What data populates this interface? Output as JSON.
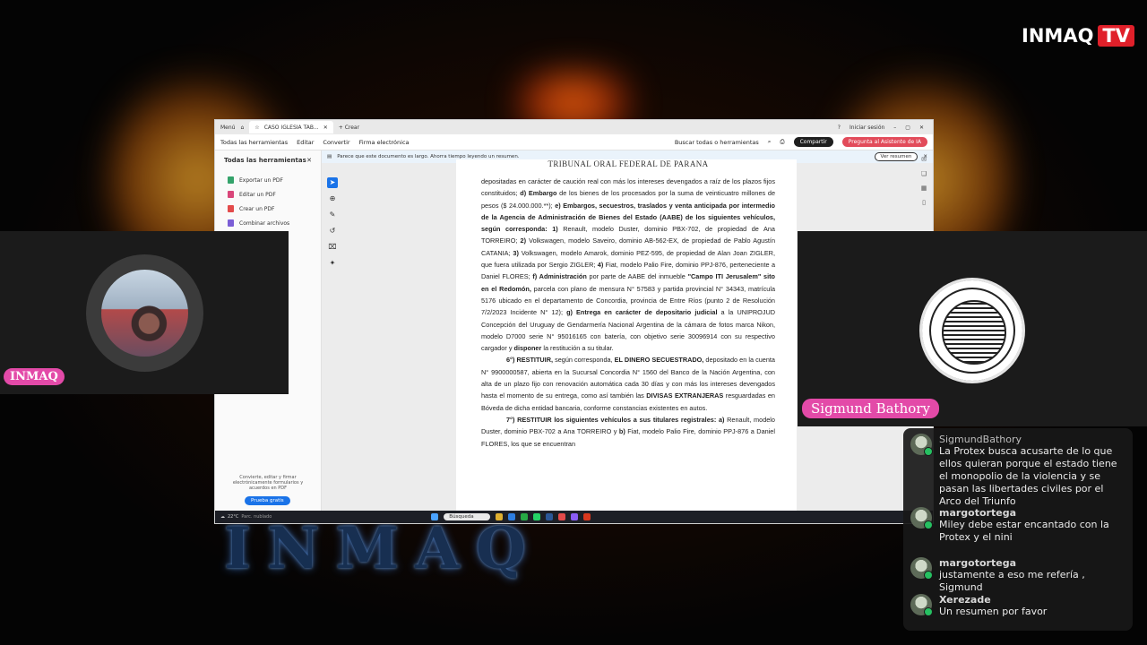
{
  "brand": {
    "name": "INMAQ",
    "tv": "TV"
  },
  "background_text": "INMAQ",
  "acrobat": {
    "tabs": {
      "menu": "Menú",
      "doc_tab": "CASO IGLESIA TAB...",
      "new_tab": "Crear"
    },
    "signin": "Iniciar sesión",
    "menu": [
      "Todas las herramientas",
      "Editar",
      "Convertir",
      "Firma electrónica"
    ],
    "search_tools": "Buscar todas o herramientas",
    "share": "Compartir",
    "ai_button": "Pregunta al Asistente de IA",
    "tools_panel": {
      "title": "Todas las herramientas",
      "items": [
        "Exportar un PDF",
        "Editar un PDF",
        "Crear un PDF",
        "Combinar archivos"
      ],
      "promo": "Convierte, editar y firmar electrónicamente formularios y acuerdos en PDF",
      "trial": "Prueba gratis"
    },
    "banner": {
      "text": "Parece que este documento es largo. Ahorra tiempo leyendo un resumen.",
      "button": "Ver resumen"
    },
    "document": {
      "header": "TRIBUNAL ORAL FEDERAL DE PARANA",
      "p1": [
        "depositadas en carácter de caución real con más los intereses devengados a raíz de los plazos fijos constituidos; ",
        "d) Embargo",
        " de los bienes de los procesados por la suma de veinticuatro millones de pesos ($ 24.000.000.**); ",
        "e) Embargos, secuestros, traslados y venta anticipada por intermedio de la Agencia de Administración de Bienes del Estado (AABE) de los siguientes vehículos, según corresponda: 1)",
        " Renault, modelo Duster, dominio PBX-702, de propiedad de Ana TORREIRO; ",
        "2)",
        " Volkswagen, modelo Saveiro, dominio AB-562-EX, de propiedad de Pablo Agustín CATANIA; ",
        "3)",
        " Volkswagen, modelo Amarok, dominio PEZ-595, de propiedad de Alan Joan ZIGLER, que fuera utilizada por Sergio ZIGLER; ",
        "4)",
        " Fiat, modelo Palio Fire, dominio PPJ-876, perteneciente a Daniel FLORES; ",
        "f) Administración",
        " por parte de AABE del inmueble ",
        "\"Campo ITI Jerusalem\" sito en el Redomón,",
        " parcela con plano de mensura N° 57583 y partida provincial N° 34343, matrícula 5176 ubicado en el departamento de Concordia, provincia de Entre Ríos (punto 2 de Resolución 7/2/2023 Incidente N° 12); ",
        "g) Entrega en carácter de depositario judicial",
        " a la UNIPROJUD Concepción del Uruguay de Gendarmería Nacional Argentina de la cámara de fotos marca Nikon, modelo D7000 serie N° 95016165 con batería, con objetivo serie 30096914 con su respectivo cargador y ",
        "disponer",
        " la restitución a su titular."
      ],
      "p2": [
        "6°) RESTITUIR,",
        " según corresponda, ",
        "EL DINERO SECUESTRADO,",
        " depositado en la cuenta N° 9900000587, abierta en la Sucursal Concordia N° 1560 del Banco de la Nación Argentina, con alta de un plazo fijo con renovación automática cada 30 días y con más los intereses devengados hasta el momento de su entrega, como así también las ",
        "DIVISAS EXTRANJERAS",
        " resguardadas en Bóveda de dicha entidad bancaria, conforme constancias existentes en autos."
      ],
      "p3": [
        "7°) RESTITUIR los siguientes vehículos a sus titulares registrales: a)",
        " Renault, modelo Duster, dominio PBX-702 a Ana TORREIRO y ",
        "b)",
        " Fiat, modelo Palio Fire, dominio PPJ-876 a Daniel FLORES, los que se encuentran"
      ]
    },
    "taskbar": {
      "weather": "22°C",
      "weather_sub": "Parc. nublado",
      "search": "Búsqueda"
    }
  },
  "hosts": {
    "left_tag": "INMAQ",
    "right_tag": "Sigmund Bathory"
  },
  "chat": [
    {
      "name": "SigmundBathory",
      "text": "La Protex busca acusarte de lo que ellos quieran porque el estado tiene el monopolio de la violencia y se pasan las libertades civiles por el Arco del Triunfo"
    },
    {
      "name": "margotortega",
      "text": "Miley debe estar encantado con la Protex y el nini"
    },
    {
      "name": "margotortega",
      "text": "justamente a eso me refería , Sigmund"
    },
    {
      "name": "Xerezade",
      "text": "Un resumen por favor"
    }
  ]
}
